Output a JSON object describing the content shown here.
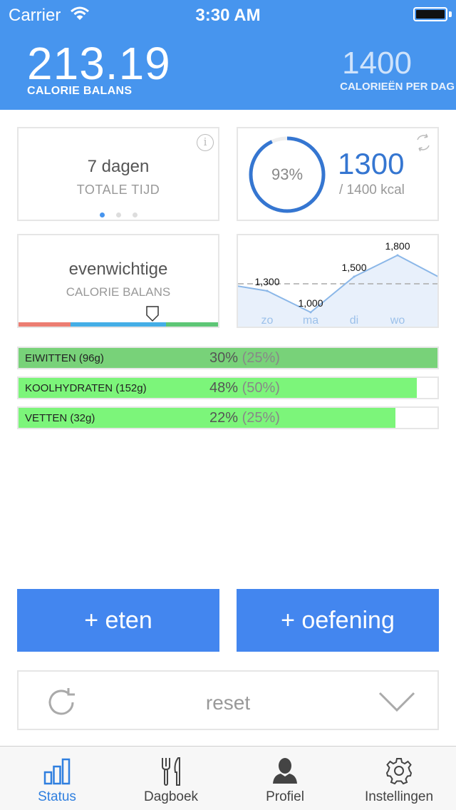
{
  "status_bar": {
    "carrier": "Carrier",
    "time": "3:30 AM"
  },
  "header": {
    "balance_value": "213.19",
    "balance_label": "CALORIE BALANS",
    "per_day_value": "1400",
    "per_day_label": "CALORIEËN PER DAG"
  },
  "time_card": {
    "value": "7 dagen",
    "label": "TOTALE TIJD",
    "page_count": 3,
    "active_page": 1
  },
  "kcal_card": {
    "percent_text": "93%",
    "percent": 93,
    "value": "1300",
    "total": "/ 1400 kcal"
  },
  "balance_card": {
    "word": "evenwichtige",
    "label": "CALORIE BALANS",
    "colors": {
      "low": "#ec7d72",
      "mid": "#44aee6",
      "high": "#5ec676"
    }
  },
  "chart_data": {
    "type": "area",
    "categories": [
      "zo",
      "ma",
      "di",
      "wo"
    ],
    "values": [
      1300,
      1000,
      1500,
      1800
    ],
    "data_labels": [
      "1,300",
      "1,000",
      "1,500",
      "1,800"
    ],
    "reference_line": 1400,
    "grid": false
  },
  "macros": [
    {
      "name": "EIWITTEN (96g)",
      "percent_text": "30%",
      "target_text": "(25%)",
      "fill": 1.0,
      "color": "#78d279"
    },
    {
      "name": "KOOLHYDRATEN (152g)",
      "percent_text": "48%",
      "target_text": "(50%)",
      "fill": 0.95,
      "color": "#7cf57a"
    },
    {
      "name": "VETTEN (32g)",
      "percent_text": "22%",
      "target_text": "(25%)",
      "fill": 0.9,
      "color": "#7cf57a"
    }
  ],
  "actions": {
    "eat_label": "+ eten",
    "exercise_label": "+ oefening",
    "reset_label": "reset"
  },
  "tabs": [
    {
      "label": "Status",
      "icon": "bar-chart-icon",
      "active": true
    },
    {
      "label": "Dagboek",
      "icon": "fork-knife-icon",
      "active": false
    },
    {
      "label": "Profiel",
      "icon": "person-icon",
      "active": false
    },
    {
      "label": "Instellingen",
      "icon": "gear-icon",
      "active": false
    }
  ],
  "colors": {
    "accent": "#4795ee",
    "button": "#4386ef",
    "active_tab": "#2f7fdf"
  }
}
